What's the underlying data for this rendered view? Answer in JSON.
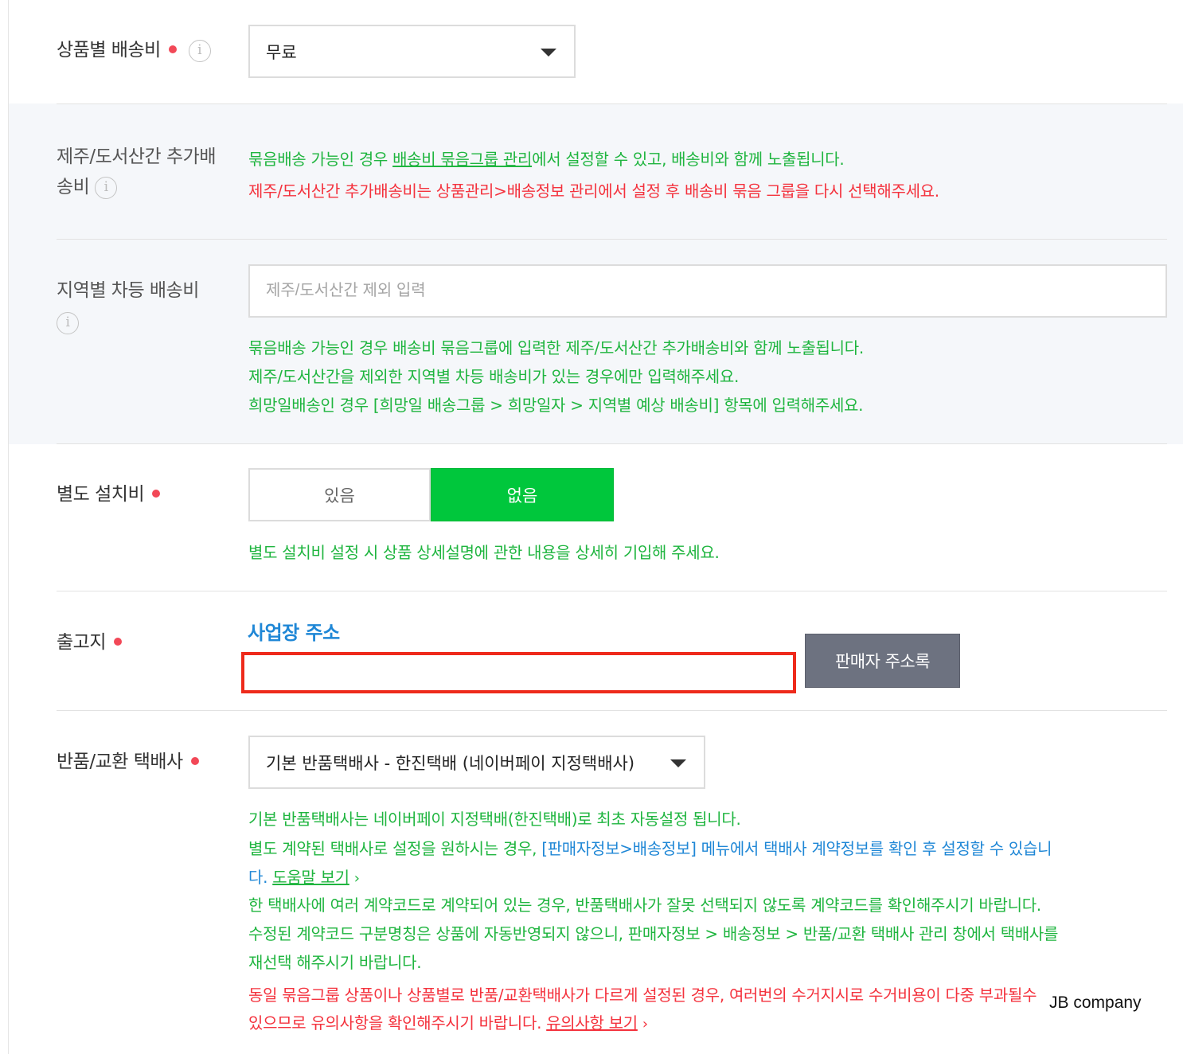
{
  "product_shipping_fee": {
    "label": "상품별 배송비",
    "selected": "무료"
  },
  "jeju_island_fee": {
    "label_line1": "제주/도서산간 추가배",
    "label_line2": "송비",
    "help_line1_prefix": "묶음배송 가능인 경우 ",
    "help_line1_link": "배송비 묶음그룹 관리",
    "help_line1_suffix": "에서 설정할 수 있고, 배송비와 함께 노출됩니다.",
    "help_line2": "제주/도서산간 추가배송비는 상품관리>배송정보 관리에서 설정 후 배송비 묶음 그룹을 다시 선택해주세요."
  },
  "regional_fee": {
    "label": "지역별 차등 배송비",
    "placeholder": "제주/도서산간 제외 입력",
    "help_line1": "묶음배송 가능인 경우 배송비 묶음그룹에 입력한 제주/도서산간 추가배송비와 함께 노출됩니다.",
    "help_line2": "제주/도서산간을 제외한 지역별 차등 배송비가 있는 경우에만 입력해주세요.",
    "help_line3": "희망일배송인 경우 [희망일 배송그룹 > 희망일자 > 지역별 예상 배송비] 항목에 입력해주세요."
  },
  "installation_fee": {
    "label": "별도 설치비",
    "option_yes": "있음",
    "option_no": "없음",
    "selected": "없음",
    "help": "별도 설치비 설정 시 상품 상세설명에 관한 내용을 상세히 기입해 주세요."
  },
  "shipping_origin": {
    "label": "출고지",
    "address_title": "사업장 주소",
    "address_value": "",
    "address_book_button": "판매자 주소록"
  },
  "return_courier": {
    "label": "반품/교환 택배사",
    "selected": "기본 반품택배사 - 한진택배 (네이버페이 지정택배사)",
    "help_line1": "기본 반품택배사는 네이버페이 지정택배(한진택배)로 최초 자동설정 됩니다.",
    "help_line2_prefix": "별도 계약된 택배사로 설정을 원하시는 경우, ",
    "help_line2_link": "[판매자정보>배송정보]",
    "help_line2_suffix": " 메뉴에서 택배사 계약정보를 확인 후 설정할 수 있습니",
    "help_line3_prefix": "다. ",
    "help_line3_link": "도움말 보기",
    "help_line4": "한 택배사에 여러 계약코드로 계약되어 있는 경우, 반품택배사가 잘못 선택되지 않도록 계약코드를 확인해주시기 바랍니다.",
    "help_line5": "수정된 계약코드 구분명칭은 상품에 자동반영되지 않으니, 판매자정보 > 배송정보 > 반품/교환 택배사 관리 창에서 택배사를",
    "help_line6": "재선택 해주시기 바랍니다.",
    "help_line7": "동일 묶음그룹 상품이나 상품별로 반품/교환택배사가 다르게 설정된 경우, 여러번의 수거지시로 수거비용이 다중 부과될수",
    "help_line8_prefix": "있으므로 유의사항을 확인해주시기 바랍니다. ",
    "help_line8_link": "유의사항 보기"
  },
  "watermark": "JB company",
  "colors": {
    "accent_green": "#00c73c",
    "help_green": "#1fb53f",
    "warning_red": "#f4323d",
    "link_blue": "#1f87d6",
    "required_dot": "#f24857",
    "highlight_box": "#ee2a1b"
  }
}
